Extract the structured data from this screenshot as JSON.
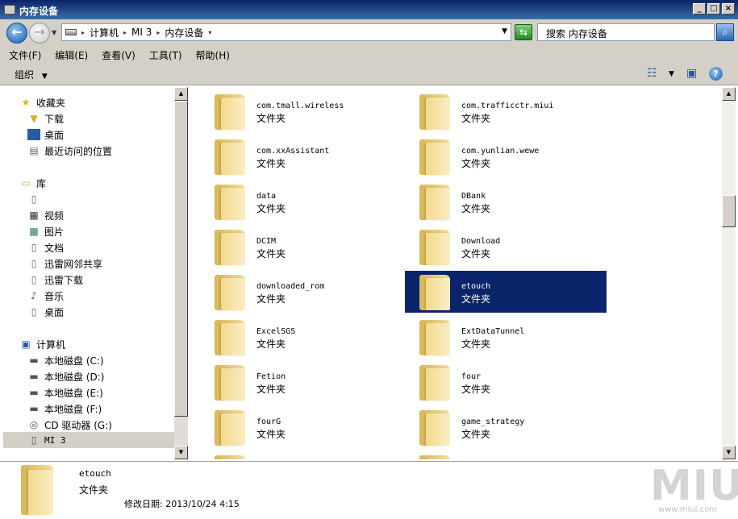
{
  "window": {
    "title": "内存设备"
  },
  "address": {
    "crumbs": [
      "计算机",
      "MI 3",
      "内存设备"
    ],
    "search_placeholder": "搜索 内存设备"
  },
  "menu": [
    "文件(F)",
    "编辑(E)",
    "查看(V)",
    "工具(T)",
    "帮助(H)"
  ],
  "toolbar": {
    "organize": "组织"
  },
  "sidebar": {
    "favorites_header": "收藏夹",
    "favorites": [
      "下载",
      "桌面",
      "最近访问的位置"
    ],
    "libraries_header": "库",
    "libraries": [
      "",
      "视频",
      "图片",
      "文档",
      "迅雷网邻共享",
      "迅雷下载",
      "音乐",
      "桌面"
    ],
    "computer_header": "计算机",
    "computer": [
      "本地磁盘 (C:)",
      "本地磁盘 (D:)",
      "本地磁盘 (E:)",
      "本地磁盘 (F:)",
      "CD 驱动器 (G:)",
      "MI 3"
    ]
  },
  "folders": [
    {
      "name": "com.tmall.wireless",
      "type": "文件夹"
    },
    {
      "name": "com.trafficctr.miui",
      "type": "文件夹"
    },
    {
      "name": "com.xxAssistant",
      "type": "文件夹"
    },
    {
      "name": "com.yunlian.wewe",
      "type": "文件夹"
    },
    {
      "name": "data",
      "type": "文件夹"
    },
    {
      "name": "DBank",
      "type": "文件夹"
    },
    {
      "name": "DCIM",
      "type": "文件夹"
    },
    {
      "name": "Download",
      "type": "文件夹"
    },
    {
      "name": "downloaded_rom",
      "type": "文件夹"
    },
    {
      "name": "etouch",
      "type": "文件夹"
    },
    {
      "name": "ExcelSGS",
      "type": "文件夹"
    },
    {
      "name": "ExtDataTunnel",
      "type": "文件夹"
    },
    {
      "name": "Fetion",
      "type": "文件夹"
    },
    {
      "name": "four",
      "type": "文件夹"
    },
    {
      "name": "fourG",
      "type": "文件夹"
    },
    {
      "name": "game_strategy",
      "type": "文件夹"
    }
  ],
  "details": {
    "name": "etouch",
    "type": "文件夹",
    "modified": "修改日期: 2013/10/24 4:15"
  },
  "watermark": {
    "url": "www.miui.com"
  },
  "colors": {
    "selection": "#0a246a",
    "chrome": "#d4d0c8",
    "folder": "#f3d98a"
  }
}
